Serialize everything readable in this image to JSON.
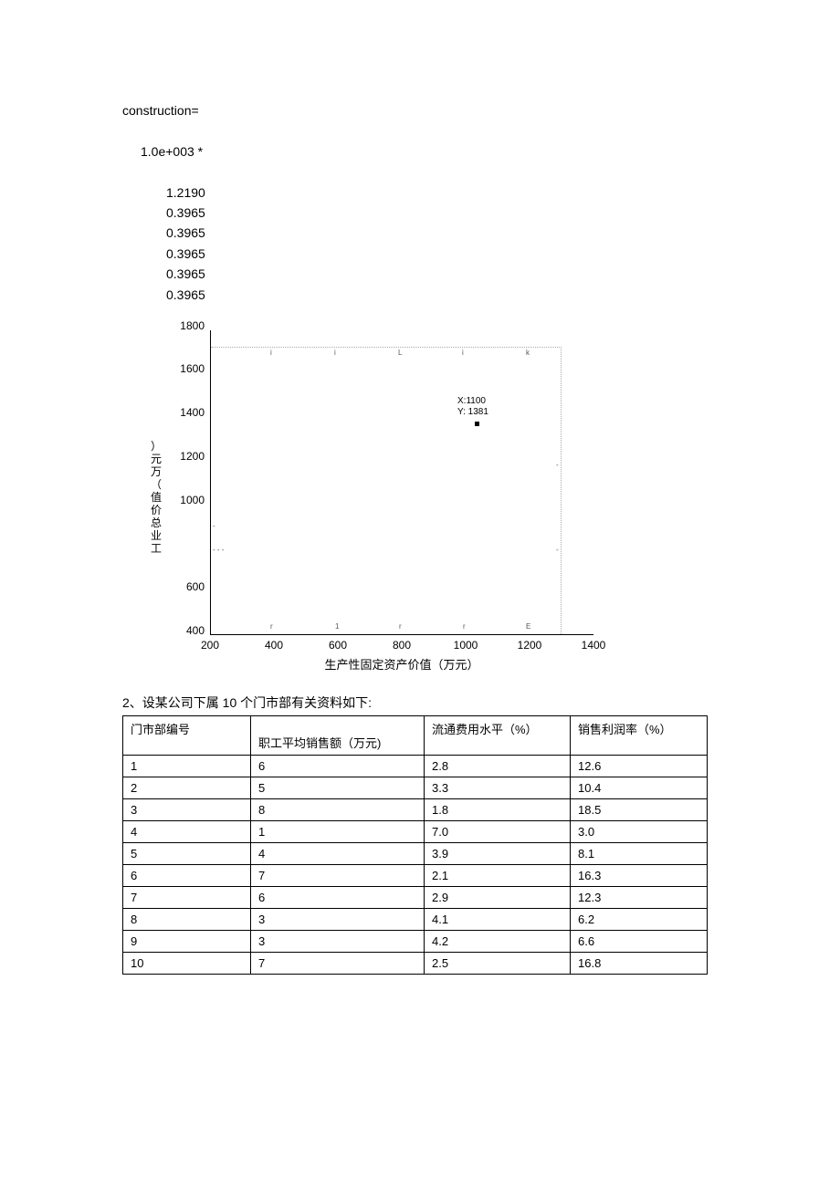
{
  "code": {
    "header": "construction=",
    "multiplier": "1.0e+003 *",
    "values": [
      "1.2190",
      "0.3965",
      "0.3965",
      "0.3965",
      "0.3965",
      "0.3965"
    ]
  },
  "chart_data": {
    "type": "scatter",
    "title": "",
    "xlabel": "生产性固定资产价值（万元）",
    "ylabel": "工业总价值（万元）",
    "xlim": [
      200,
      1400
    ],
    "ylim": [
      400,
      1800
    ],
    "x_ticks": [
      200,
      400,
      600,
      800,
      1000,
      1200,
      1400
    ],
    "y_ticks": [
      400,
      600,
      1000,
      1200,
      1400,
      1600,
      1800
    ],
    "series": [
      {
        "name": "point",
        "x": [
          1100
        ],
        "y": [
          1381
        ]
      }
    ],
    "annotation": {
      "x_label": "X:1100",
      "y_label": "Y: 1381"
    }
  },
  "question2": {
    "heading": "2、设某公司下属 10 个门市部有关资料如下:",
    "columns": [
      "门市部编号",
      "职工平均销售额（万元)",
      "流通费用水平（%）",
      "销售利润率（%）"
    ],
    "rows": [
      [
        "1",
        "6",
        "2.8",
        "12.6"
      ],
      [
        "2",
        "5",
        "3.3",
        "10.4"
      ],
      [
        "3",
        "8",
        "1.8",
        "18.5"
      ],
      [
        "4",
        "1",
        "7.0",
        "3.0"
      ],
      [
        "5",
        "4",
        "3.9",
        "8.1"
      ],
      [
        "6",
        "7",
        "2.1",
        "16.3"
      ],
      [
        "7",
        "6",
        "2.9",
        "12.3"
      ],
      [
        "8",
        "3",
        "4.1",
        "6.2"
      ],
      [
        "9",
        "3",
        "4.2",
        "6.6"
      ],
      [
        "10",
        "7",
        "2.5",
        "16.8"
      ]
    ]
  }
}
